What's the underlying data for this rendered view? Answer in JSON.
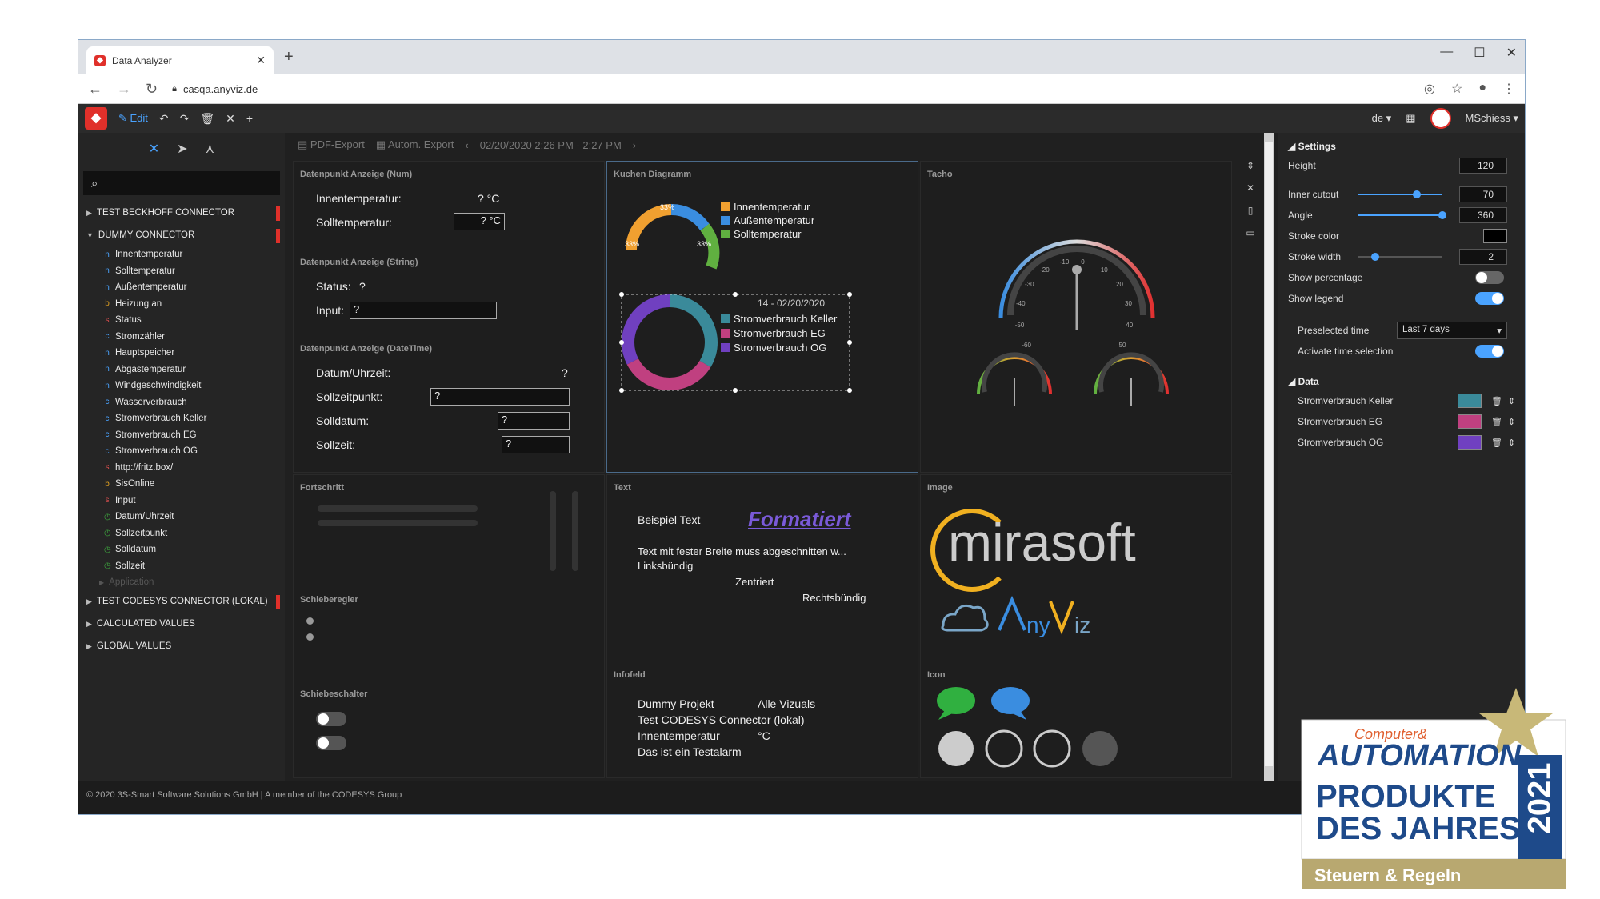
{
  "browser": {
    "tab_title": "Data Analyzer",
    "url": "casqa.anyviz.de"
  },
  "toolbar": {
    "edit_label": "Edit",
    "language": "de",
    "user": "MSchiess"
  },
  "topbar": {
    "pdf_export": "PDF-Export",
    "autom_export": "Autom. Export",
    "time_range": "02/20/2020 2:26 PM - 2:27 PM"
  },
  "sidebar": {
    "connectors": [
      {
        "label": "TEST BECKHOFF CONNECTOR"
      },
      {
        "label": "DUMMY CONNECTOR"
      }
    ],
    "datapoints": [
      {
        "type": "n",
        "label": "Innentemperatur"
      },
      {
        "type": "n",
        "label": "Solltemperatur"
      },
      {
        "type": "n",
        "label": "Außentemperatur"
      },
      {
        "type": "b",
        "label": "Heizung an"
      },
      {
        "type": "s",
        "label": "Status"
      },
      {
        "type": "c",
        "label": "Stromzähler"
      },
      {
        "type": "n",
        "label": "Hauptspeicher"
      },
      {
        "type": "n",
        "label": "Abgastemperatur"
      },
      {
        "type": "n",
        "label": "Windgeschwindigkeit"
      },
      {
        "type": "c",
        "label": "Wasserverbrauch"
      },
      {
        "type": "c",
        "label": "Stromverbrauch Keller"
      },
      {
        "type": "c",
        "label": "Stromverbrauch EG"
      },
      {
        "type": "c",
        "label": "Stromverbrauch OG"
      },
      {
        "type": "s",
        "label": "http://fritz.box/"
      },
      {
        "type": "b",
        "label": "SisOnline"
      },
      {
        "type": "s",
        "label": "Input"
      },
      {
        "type": "t",
        "label": "Datum/Uhrzeit"
      },
      {
        "type": "t",
        "label": "Sollzeitpunkt"
      },
      {
        "type": "t",
        "label": "Solldatum"
      },
      {
        "type": "t",
        "label": "Sollzeit"
      }
    ],
    "application": "Application",
    "more_connectors": [
      {
        "label": "TEST CODESYS CONNECTOR (LOKAL)"
      },
      {
        "label": "CALCULATED VALUES"
      },
      {
        "label": "GLOBAL VALUES"
      }
    ]
  },
  "panels": {
    "num": {
      "title": "Datenpunkt Anzeige (Num)",
      "inntemp_label": "Innentemperatur:",
      "inntemp_value": "? °C",
      "solltemp_label": "Solltemperatur:",
      "solltemp_value": "? °C"
    },
    "string": {
      "title": "Datenpunkt Anzeige (String)",
      "status_label": "Status:",
      "status_value": "?",
      "input_label": "Input:",
      "input_value": "?"
    },
    "datetime": {
      "title": "Datenpunkt Anzeige (DateTime)",
      "datum_label": "Datum/Uhrzeit:",
      "datum_value": "?",
      "sollzeitpunkt_label": "Sollzeitpunkt:",
      "sollzeitpunkt_value": "?",
      "solldatum_label": "Solldatum:",
      "solldatum_value": "?",
      "sollzeit_label": "Sollzeit:",
      "sollzeit_value": "?"
    },
    "kuchen": {
      "title": "Kuchen Diagramm",
      "legend1": [
        "Innentemperatur",
        "Außentemperatur",
        "Solltemperatur"
      ],
      "legend1_colors": [
        "#f0a030",
        "#3a8de0",
        "#60b040"
      ],
      "pct_top": "33%",
      "pct_left": "33%",
      "pct_right": "33%",
      "date_label": "14 - 02/20/2020",
      "legend2": [
        "Stromverbrauch Keller",
        "Stromverbrauch EG",
        "Stromverbrauch OG"
      ],
      "legend2_colors": [
        "#3a8a9a",
        "#c04080",
        "#7040c0"
      ]
    },
    "tacho": {
      "title": "Tacho",
      "ticks": [
        "-60",
        "-50",
        "-40",
        "-30",
        "-20",
        "-10",
        "0",
        "10",
        "20",
        "30",
        "40",
        "50"
      ]
    },
    "fortschritt": {
      "title": "Fortschritt"
    },
    "schieberegler": {
      "title": "Schieberegler"
    },
    "schiebeschalter": {
      "title": "Schiebeschalter"
    },
    "text": {
      "title": "Text",
      "beispiel": "Beispiel Text",
      "formatiert": "Formatiert",
      "fixed": "Text mit fester Breite muss abgeschnitten w...",
      "links": "Linksbündig",
      "zentriert": "Zentriert",
      "rechts": "Rechtsbündig"
    },
    "infofeld": {
      "title": "Infofeld",
      "line1a": "Dummy Projekt",
      "line1b": "Alle Vizuals",
      "line2": "Test CODESYS Connector (lokal)",
      "line3a": "Innentemperatur",
      "line3b": "°C",
      "line4": "Das ist ein Testalarm"
    },
    "image": {
      "title": "Image",
      "logo1": "mirasoft",
      "logo2_a": "ny",
      "logo2_b": "iz"
    },
    "icon": {
      "title": "Icon"
    }
  },
  "settings": {
    "section": "Settings",
    "height_label": "Height",
    "height_value": "120",
    "inner_label": "Inner cutout",
    "inner_value": "70",
    "inner_fraction": 0.7,
    "angle_label": "Angle",
    "angle_value": "360",
    "angle_fraction": 1.0,
    "stroke_color_label": "Stroke color",
    "stroke_color": "#000000",
    "stroke_width_label": "Stroke width",
    "stroke_width_value": "2",
    "stroke_width_fraction": 0.2,
    "show_pct_label": "Show percentage",
    "show_pct": false,
    "show_legend_label": "Show legend",
    "show_legend": true,
    "preselected_label": "Preselected time",
    "preselected_value": "Last 7 days",
    "activate_label": "Activate time selection",
    "activate": true,
    "data_section": "Data",
    "data": [
      {
        "label": "Stromverbrauch Keller",
        "color": "#3a8a9a"
      },
      {
        "label": "Stromverbrauch EG",
        "color": "#c04080"
      },
      {
        "label": "Stromverbrauch OG",
        "color": "#7040c0"
      }
    ]
  },
  "footer": "© 2020 3S-Smart Software Solutions GmbH | A member of the CODESYS Group",
  "badge": {
    "brand_small": "Computer&",
    "brand_big": "AUTOMATION",
    "line1": "PRODUKTE",
    "line2": "DES JAHRES",
    "year": "2021",
    "bottom": "Steuern & Regeln"
  }
}
